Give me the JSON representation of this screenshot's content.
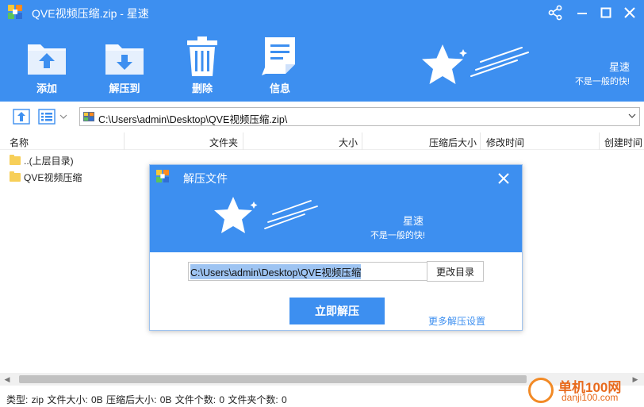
{
  "window": {
    "title": "QVE视频压缩.zip - 星速",
    "controls": [
      "share-icon",
      "minimize-icon",
      "maximize-icon",
      "close-icon"
    ]
  },
  "toolbar": {
    "items": [
      {
        "label": "添加",
        "icon": "add-archive-icon"
      },
      {
        "label": "解压到",
        "icon": "extract-to-icon"
      },
      {
        "label": "删除",
        "icon": "trash-icon"
      },
      {
        "label": "信息",
        "icon": "info-doc-icon"
      }
    ]
  },
  "brand": {
    "name": "星速",
    "slogan": "不是一般的快!"
  },
  "address": {
    "path": "C:\\Users\\admin\\Desktop\\QVE视频压缩.zip\\"
  },
  "file_list": {
    "columns": [
      "名称",
      "文件夹",
      "大小",
      "压缩后大小",
      "修改时间",
      "创建时间"
    ],
    "rows": [
      {
        "name": "..(上层目录)"
      },
      {
        "name": "QVE视频压缩"
      }
    ]
  },
  "status": {
    "text": "类型: zip  文件大小: 0B 压缩后大小: 0B  文件个数: 0  文件夹个数: 0"
  },
  "dialog": {
    "title": "解压文件",
    "brand_name": "星速",
    "brand_slogan": "不是一般的快!",
    "path_value": "C:\\Users\\admin\\Desktop\\QVE视频压缩",
    "change_dir_label": "更改目录",
    "extract_label": "立即解压",
    "more_settings_label": "更多解压设置"
  },
  "watermark": {
    "text": "单机100网",
    "sub": "danji100.com"
  },
  "colors": {
    "primary": "#3d8ff0",
    "watermark": "#e86a1c"
  }
}
